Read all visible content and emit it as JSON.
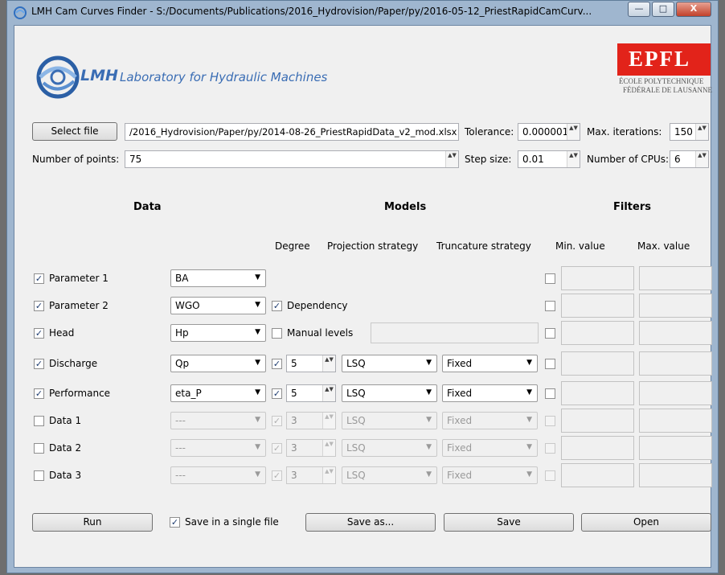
{
  "window": {
    "title": "LMH Cam Curves Finder - S:/Documents/Publications/2016_Hydrovision/Paper/py/2016-05-12_PriestRapidCamCurv...",
    "minimize": "—",
    "maximize": "□",
    "close": "X"
  },
  "header": {
    "lmh_acronym": "LMH",
    "lmh_name": "Laboratory for Hydraulic Machines",
    "epfl_logo": "EPFL",
    "epfl_line1": "ÉCOLE POLYTECHNIQUE",
    "epfl_line2": "FÉDÉRALE DE LAUSANNE",
    "colors": {
      "lmh_blue": "#3a6db4",
      "epfl_red": "#e2231a"
    }
  },
  "file": {
    "select_label": "Select file",
    "path": "/2016_Hydrovision/Paper/py/2014-08-26_PriestRapidData_v2_mod.xlsx"
  },
  "settings": {
    "tolerance_label": "Tolerance:",
    "tolerance": "0.000001",
    "max_iter_label": "Max. iterations:",
    "max_iter": "150",
    "points_label": "Number of points:",
    "points": "75",
    "step_label": "Step size:",
    "step": "0.01",
    "cpus_label": "Number of CPUs:",
    "cpus": "6"
  },
  "sections": {
    "data": "Data",
    "models": "Models",
    "filters": "Filters"
  },
  "columns": {
    "degree": "Degree",
    "projection": "Projection strategy",
    "truncature": "Truncature strategy",
    "min": "Min. value",
    "max": "Max. value"
  },
  "misc": {
    "dependency": "Dependency",
    "manual_levels": "Manual levels",
    "check": "✓",
    "arrows": "▲▼",
    "dropdown": "▼"
  },
  "rows": [
    {
      "label": "Parameter 1",
      "var": "BA"
    },
    {
      "label": "Parameter 2",
      "var": "WGO"
    },
    {
      "label": "Head",
      "var": "Hp"
    },
    {
      "label": "Discharge",
      "var": "Qp",
      "degree": "5",
      "projection": "LSQ",
      "truncature": "Fixed"
    },
    {
      "label": "Performance",
      "var": "eta_P",
      "degree": "5",
      "projection": "LSQ",
      "truncature": "Fixed"
    },
    {
      "label": "Data 1",
      "var": "---",
      "degree": "3",
      "projection": "LSQ",
      "truncature": "Fixed"
    },
    {
      "label": "Data 2",
      "var": "---",
      "degree": "3",
      "projection": "LSQ",
      "truncature": "Fixed"
    },
    {
      "label": "Data 3",
      "var": "---",
      "degree": "3",
      "projection": "LSQ",
      "truncature": "Fixed"
    }
  ],
  "actions": {
    "run": "Run",
    "single_file": "Save in a single file",
    "save_as": "Save as...",
    "save": "Save",
    "open": "Open"
  }
}
